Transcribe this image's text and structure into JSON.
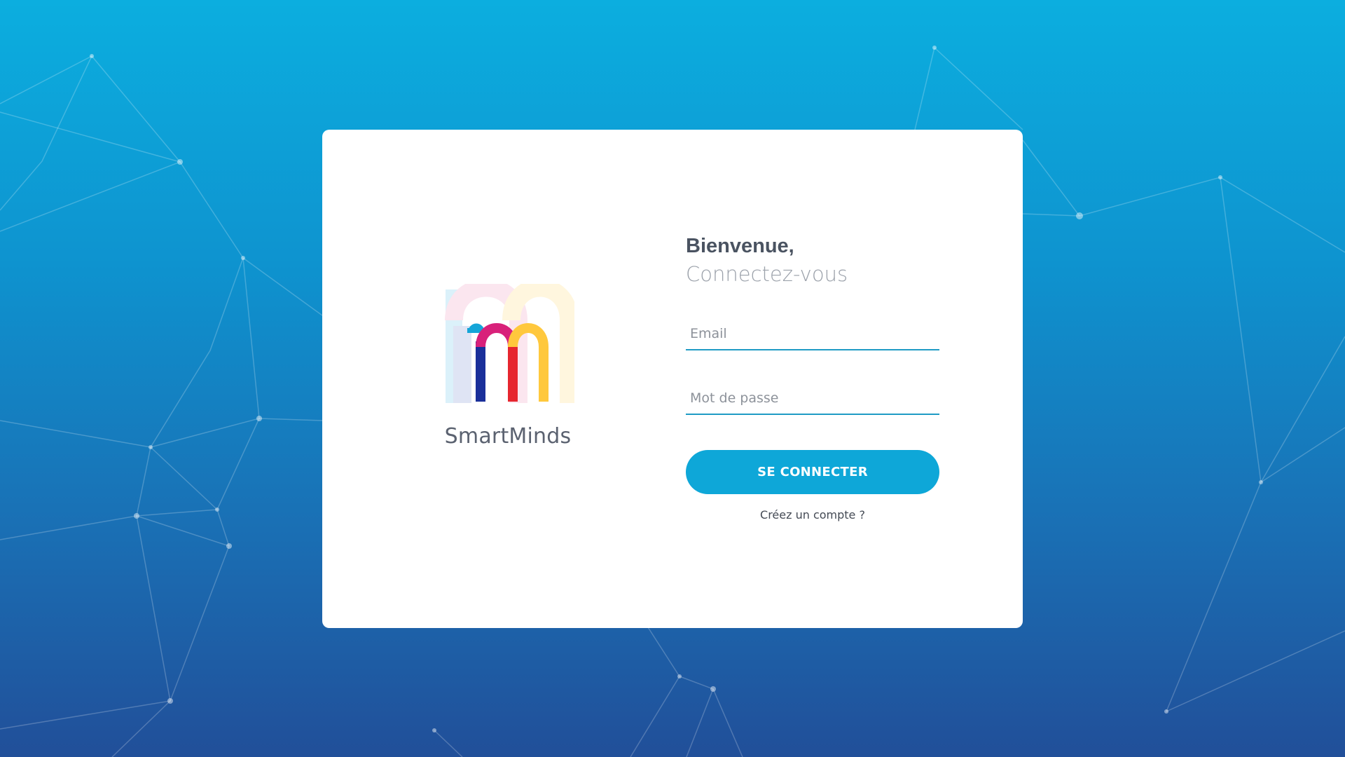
{
  "brand": {
    "name": "SmartMinds",
    "logo_icon": "smartminds-m-logo-icon",
    "logo_colors": [
      "#1a2f9a",
      "#d8217a",
      "#e6262f",
      "#ffc83d",
      "#15a5d8"
    ]
  },
  "login": {
    "title": "Bienvenue,",
    "subtitle": "Connectez-vous",
    "email_placeholder": "Email",
    "email_value": "",
    "password_placeholder": "Mot de passe",
    "password_value": "",
    "submit_label": "SE CONNECTER",
    "signup_link": "Créez un compte ?"
  },
  "colors": {
    "accent": "#0ea7d8",
    "input_underline": "#1f9bc5",
    "background_top": "#0caedf",
    "background_bottom": "#214f99"
  }
}
